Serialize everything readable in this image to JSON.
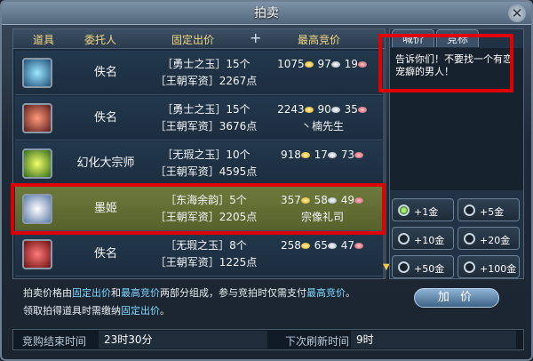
{
  "window": {
    "title": "拍卖",
    "close_glyph": "✕"
  },
  "table": {
    "headers": [
      "道具",
      "委托人",
      "固定出价",
      "+",
      "最高竞价"
    ],
    "rows": [
      {
        "seller": "佚名",
        "fixed1": "［勇士之玉］15个",
        "fixed2": "［王朝军资］2267点",
        "gold": "1075",
        "silver": "97",
        "copper": "19",
        "bidder": "",
        "selected": false
      },
      {
        "seller": "佚名",
        "fixed1": "［勇士之玉］15个",
        "fixed2": "［王朝军资］3676点",
        "gold": "2243",
        "silver": "90",
        "copper": "35",
        "bidder": "丶楠先生",
        "selected": false
      },
      {
        "seller": "幻化大宗师",
        "fixed1": "［无瑕之玉］10个",
        "fixed2": "［王朝军资］4595点",
        "gold": "918",
        "silver": "17",
        "copper": "73",
        "bidder": "",
        "selected": false
      },
      {
        "seller": "墨姬",
        "fixed1": "［东海余韵］5个",
        "fixed2": "［王朝军资］2205点",
        "gold": "357",
        "silver": "58",
        "copper": "49",
        "bidder": "宗像礼司",
        "selected": true
      },
      {
        "seller": "佚名",
        "fixed1": "［无瑕之玉］8个",
        "fixed2": "［王朝军资］1225点",
        "gold": "258",
        "silver": "65",
        "copper": "47",
        "bidder": "",
        "selected": false
      }
    ]
  },
  "right_panel": {
    "tabs": [
      "喊价",
      "竞标"
    ],
    "message": "告诉你们！不要找一个有恋宠癖的男人！",
    "options": [
      "+1金",
      "+5金",
      "+10金",
      "+20金",
      "+50金",
      "+100金"
    ],
    "selected_option": "+1金",
    "bid_button": "加 价"
  },
  "info": {
    "p1_a": "拍卖价格由",
    "p1_hl1": "固定出价",
    "p1_b": "和",
    "p1_hl2": "最高竞价",
    "p1_c": "两部分组成，参与竞拍时仅需支付",
    "p1_hl3": "最高竞价",
    "p1_d": "。",
    "p2_a": "领取拍得道具时需缴纳",
    "p2_hl": "固定出价",
    "p2_b": "。"
  },
  "footer": {
    "end_label": "竞购结束时间",
    "end_value": "23时30分",
    "refresh_label": "下次刷新时间",
    "refresh_value": "9时"
  },
  "colors": {
    "highlight_text": "#7fd8ff",
    "selected_row": "#6e7a3c",
    "annotation_red": "#e00000"
  }
}
